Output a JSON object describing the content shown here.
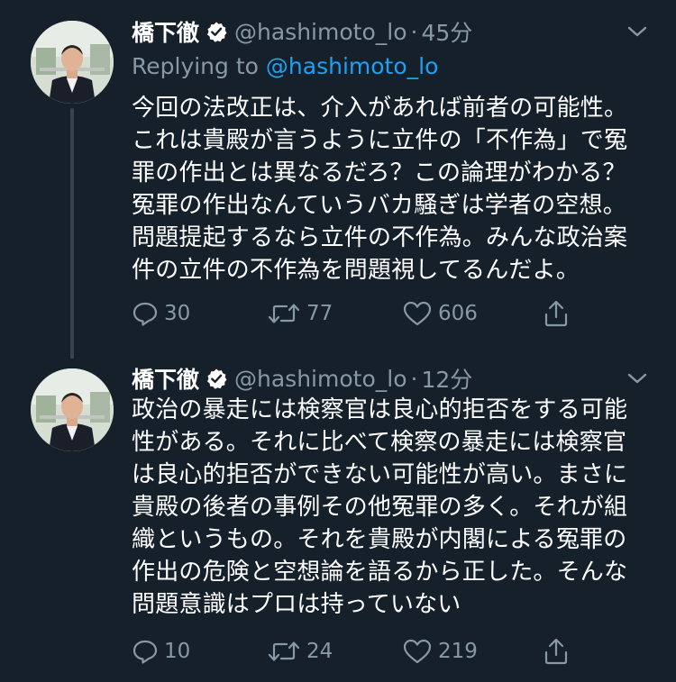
{
  "thread": {
    "tweets": [
      {
        "author_name": "橋下徹",
        "handle": "@hashimoto_lo",
        "separator": "·",
        "time": "45分",
        "reply_prefix": "Replying to",
        "reply_to": "@hashimoto_lo",
        "lines": [
          "今回の法改正は、介入があれば前者の可能性。",
          "これは貴殿が言うように立件の「不作為」で冤",
          "罪の作出とは異なるだろ？この論理がわかる？",
          "冤罪の作出なんていうバカ騒ぎは学者の空想。",
          "問題提起するなら立件の不作為。みんな政治案",
          "件の立件の不作為を問題視してるんだよ。"
        ],
        "replies": "30",
        "retweets": "77",
        "likes": "606"
      },
      {
        "author_name": "橋下徹",
        "handle": "@hashimoto_lo",
        "separator": "·",
        "time": "12分",
        "lines": [
          "政治の暴走には検察官は良心的拒否をする可能",
          "性がある。それに比べて検察の暴走には検察官",
          "は良心的拒否ができない可能性が高い。まさに",
          "貴殿の後者の事例その他冤罪の多く。それが組",
          "織というもの。それを貴殿が内閣による冤罪の",
          "作出の危険と空想論を語るから正した。そんな",
          "問題意識はプロは持っていない"
        ],
        "replies": "10",
        "retweets": "24",
        "likes": "219"
      }
    ]
  },
  "colors": {
    "background": "#15202b",
    "text_primary": "#ffffff",
    "text_secondary": "#8899a6",
    "link": "#1da1f2",
    "thread_line": "#38444d"
  },
  "icons": {
    "verified": "verified-badge-icon",
    "more": "chevron-down-icon",
    "reply": "reply-icon",
    "retweet": "retweet-icon",
    "like": "heart-icon",
    "share": "share-icon"
  }
}
